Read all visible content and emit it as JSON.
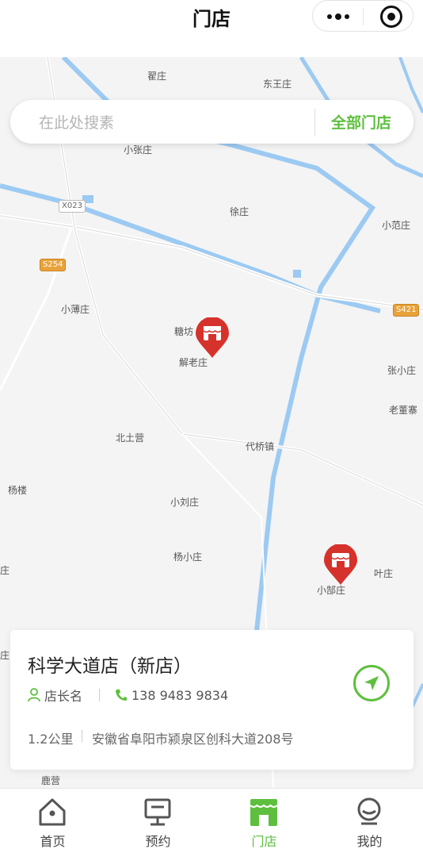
{
  "header": {
    "title": "门店"
  },
  "capsule": {
    "more_icon": "more-dots-icon",
    "close_icon": "target-icon"
  },
  "search": {
    "placeholder": "在此处搜素",
    "all_stores": "全部门店"
  },
  "map": {
    "places": [
      "翟庄",
      "东王庄",
      "小张庄",
      "徐庄",
      "小范庄",
      "小薄庄",
      "糖坊",
      "解老庄",
      "张小庄",
      "老董寨",
      "北土营",
      "代桥镇",
      "杨楼",
      "小刘庄",
      "杨小庄",
      "叶庄",
      "小郜庄",
      "鹿营",
      "庄",
      "庄"
    ],
    "roads": [
      "X023",
      "S254",
      "S421"
    ]
  },
  "card": {
    "store_name": "科学大道店（新店）",
    "manager": "店长名",
    "phone": "138 9483 9834",
    "distance": "1.2公里",
    "address": "安徽省阜阳市颍泉区创科大道208号"
  },
  "tabs": [
    {
      "label": "首页",
      "icon": "home-icon"
    },
    {
      "label": "预约",
      "icon": "booking-icon"
    },
    {
      "label": "门店",
      "icon": "store-icon"
    },
    {
      "label": "我的",
      "icon": "profile-icon"
    }
  ],
  "colors": {
    "accent": "#5ebf3e",
    "marker": "#d6322c",
    "river": "#9ccaf2"
  }
}
